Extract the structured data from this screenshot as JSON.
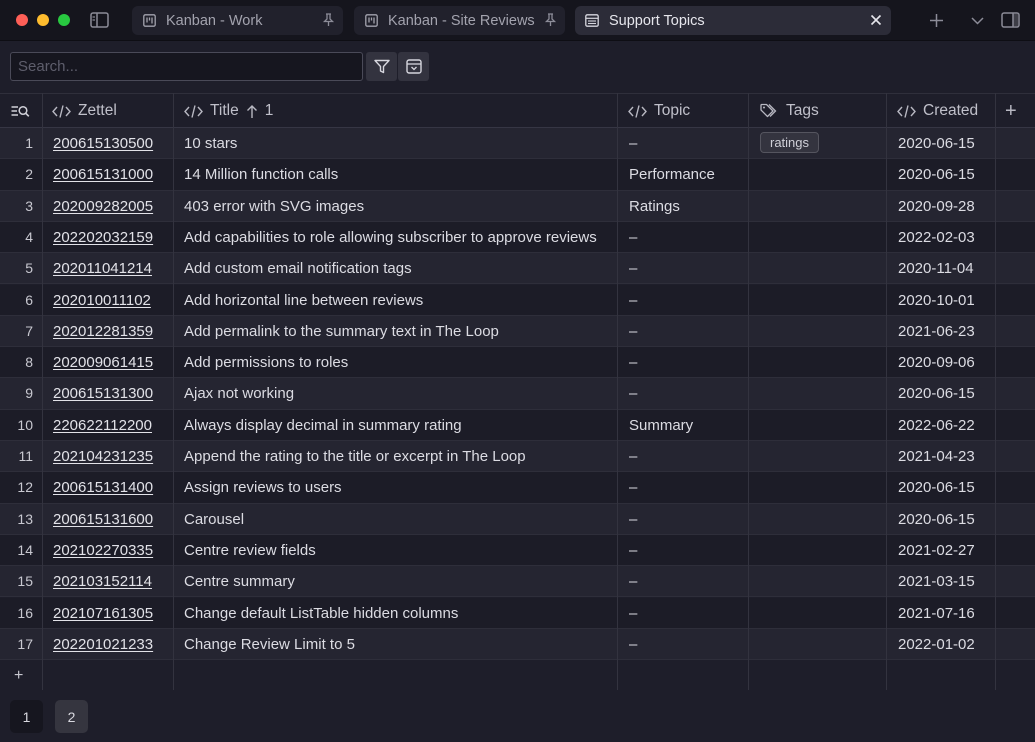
{
  "tabs": [
    {
      "label": "Kanban - Work",
      "icon": "kanban-icon",
      "end_icon": "pin-icon"
    },
    {
      "label": "Kanban - Site Reviews",
      "icon": "kanban-icon",
      "end_icon": "pin-icon"
    },
    {
      "label": "Support Topics",
      "icon": "table-icon",
      "end_icon": "close-icon",
      "active": true
    }
  ],
  "toolbar": {
    "search_placeholder": "Search...",
    "search_value": ""
  },
  "columns": {
    "zettel": "Zettel",
    "title": "Title",
    "title_sort_rank": "1",
    "topic": "Topic",
    "tags": "Tags",
    "created": "Created"
  },
  "rows": [
    {
      "num": "1",
      "zettel": "200615130500",
      "title": "10 stars",
      "topic": "–",
      "tag": "ratings",
      "created": "2020-06-15"
    },
    {
      "num": "2",
      "zettel": "200615131000",
      "title": "14 Million function calls",
      "topic": "Performance",
      "tag": "",
      "created": "2020-06-15"
    },
    {
      "num": "3",
      "zettel": "202009282005",
      "title": "403 error with SVG images",
      "topic": "Ratings",
      "tag": "",
      "created": "2020-09-28"
    },
    {
      "num": "4",
      "zettel": "202202032159",
      "title": "Add capabilities to role allowing subscriber to approve reviews",
      "topic": "–",
      "tag": "",
      "created": "2022-02-03"
    },
    {
      "num": "5",
      "zettel": "202011041214",
      "title": "Add custom email notification tags",
      "topic": "–",
      "tag": "",
      "created": "2020-11-04"
    },
    {
      "num": "6",
      "zettel": "202010011102",
      "title": "Add horizontal line between reviews",
      "topic": "–",
      "tag": "",
      "created": "2020-10-01"
    },
    {
      "num": "7",
      "zettel": "202012281359",
      "title": "Add permalink to the summary text in The Loop",
      "topic": "–",
      "tag": "",
      "created": "2021-06-23"
    },
    {
      "num": "8",
      "zettel": "202009061415",
      "title": "Add permissions to roles",
      "topic": "–",
      "tag": "",
      "created": "2020-09-06"
    },
    {
      "num": "9",
      "zettel": "200615131300",
      "title": "Ajax not working",
      "topic": "–",
      "tag": "",
      "created": "2020-06-15"
    },
    {
      "num": "10",
      "zettel": "220622112200",
      "title": "Always display decimal in summary rating",
      "topic": "Summary",
      "tag": "",
      "created": "2022-06-22"
    },
    {
      "num": "11",
      "zettel": "202104231235",
      "title": "Append the rating to the title or excerpt in The Loop",
      "topic": "–",
      "tag": "",
      "created": "2021-04-23"
    },
    {
      "num": "12",
      "zettel": "200615131400",
      "title": "Assign reviews to users",
      "topic": "–",
      "tag": "",
      "created": "2020-06-15"
    },
    {
      "num": "13",
      "zettel": "200615131600",
      "title": "Carousel",
      "topic": "–",
      "tag": "",
      "created": "2020-06-15"
    },
    {
      "num": "14",
      "zettel": "202102270335",
      "title": "Centre review fields",
      "topic": "–",
      "tag": "",
      "created": "2021-02-27"
    },
    {
      "num": "15",
      "zettel": "202103152114",
      "title": "Centre summary",
      "topic": "–",
      "tag": "",
      "created": "2021-03-15"
    },
    {
      "num": "16",
      "zettel": "202107161305",
      "title": "Change default ListTable hidden columns",
      "topic": "–",
      "tag": "",
      "created": "2021-07-16"
    },
    {
      "num": "17",
      "zettel": "202201021233",
      "title": "Change Review Limit to 5",
      "topic": "–",
      "tag": "",
      "created": "2022-01-02"
    }
  ],
  "add_row_label": "+",
  "add_column_label": "+",
  "pages": [
    "1",
    "2"
  ],
  "current_page": "2",
  "colors": {
    "background": "#1e1e2a",
    "row_odd": "#252531",
    "row_even": "#1c1c27",
    "close_red": "#fe5f57",
    "minimize_yellow": "#febc2e",
    "zoom_green": "#28c840"
  }
}
